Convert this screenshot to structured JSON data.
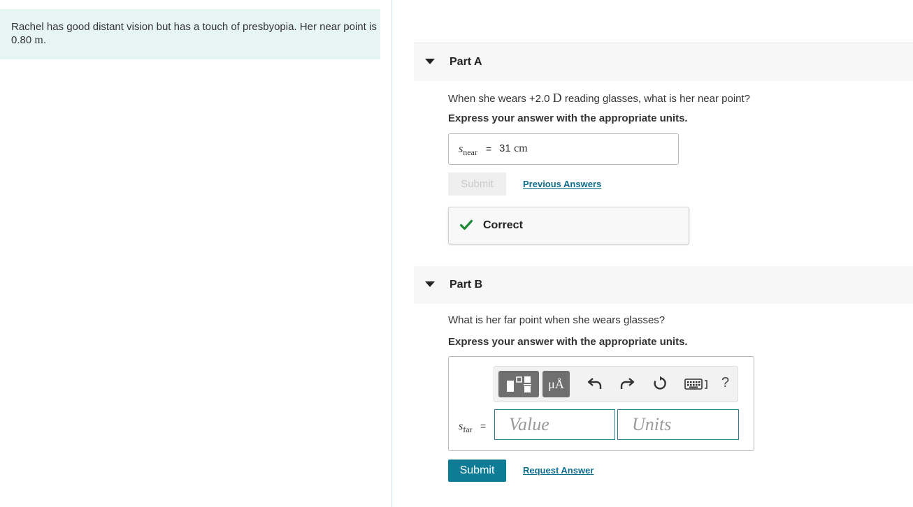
{
  "intro": {
    "text_before": "Rachel has good distant vision but has a touch of presbyopia. Her near point is ",
    "value": "0.80",
    "unit": "m",
    "text_after": "."
  },
  "part_a": {
    "title": "Part A",
    "question_before": "When she wears +2.0 ",
    "question_unit": "D",
    "question_after": " reading glasses, what is her near point?",
    "instruction": "Express your answer with the appropriate units.",
    "var_main": "s",
    "var_sub": "near",
    "equals": "=",
    "answer_value": "31",
    "answer_unit": "cm",
    "submit_label": "Submit",
    "previous_answers_label": "Previous Answers",
    "feedback_label": "Correct",
    "feedback_color": "#1e8a36"
  },
  "part_b": {
    "title": "Part B",
    "question": "What is her far point when she wears glasses?",
    "instruction": "Express your answer with the appropriate units.",
    "toolbar": {
      "templates_icon": "templates-icon",
      "units_label": "μÅ",
      "undo_icon": "undo-icon",
      "redo_icon": "redo-icon",
      "reset_icon": "reset-icon",
      "keyboard_icon": "keyboard-icon",
      "help_label": "?"
    },
    "var_main": "s",
    "var_sub": "far",
    "equals": "=",
    "value_placeholder": "Value",
    "units_placeholder": "Units",
    "submit_label": "Submit",
    "request_answer_label": "Request Answer"
  },
  "colors": {
    "intro_bg": "#e6f5f4",
    "accent": "#0f7c96",
    "link": "#0e6e8e"
  }
}
